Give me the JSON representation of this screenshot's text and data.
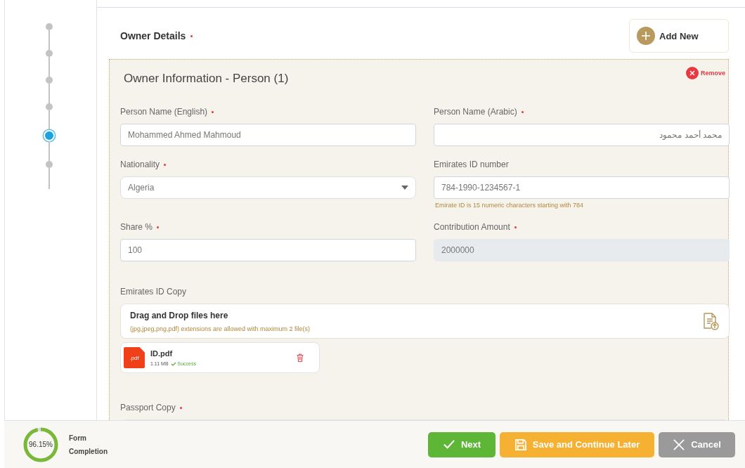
{
  "stepper": {
    "steps": [
      {
        "selected": false
      },
      {
        "selected": false
      },
      {
        "selected": false
      },
      {
        "selected": false
      },
      {
        "selected": true
      },
      {
        "selected": false
      }
    ]
  },
  "section": {
    "title": "Owner Details",
    "required": true,
    "add_button": "Add New"
  },
  "owner_card": {
    "title": "Owner Information - Person (1)",
    "remove_label": "Remove",
    "fields": [
      {
        "label": "Person Name (English)",
        "required": true,
        "kind": "text",
        "value": "Mohammed Ahmed Mahmoud"
      },
      {
        "label": "Person Name (Arabic)",
        "required": true,
        "kind": "text",
        "value": "محمد أحمد محمود"
      },
      {
        "label": "Nationality",
        "required": true,
        "kind": "select",
        "value": "Algeria"
      },
      {
        "label": "Emirates ID number",
        "kind": "text",
        "value": "784-1990-1234567-1",
        "hint": "Emirate ID is 15 numeric characters starting with 784"
      },
      {
        "label": "Share %",
        "required": true,
        "kind": "text",
        "value": "100"
      },
      {
        "label": "Contribution Amount",
        "required": true,
        "kind": "readonly",
        "value": "2000000"
      }
    ],
    "uploads": [
      {
        "label": "Emirates ID Copy",
        "dropzone_title": "Drag and Drop files here",
        "dropzone_hint": "(jpg,jpeg,png,pdf) extensions are allowed with maximum 2 file(s)",
        "files": [
          {
            "name": "ID.pdf",
            "type": ".pdf",
            "size": "1.11 MB",
            "status": "Success"
          }
        ]
      },
      {
        "label": "Passport Copy",
        "required": true
      }
    ]
  },
  "footer": {
    "progress": {
      "reading": "96.15%",
      "level": 0.9615,
      "label": "Form Completion"
    },
    "buttons": [
      {
        "label": "Next",
        "kind": "next"
      },
      {
        "label": "Save and Continue Later",
        "kind": "save"
      },
      {
        "label": "Cancel",
        "kind": "cancel"
      }
    ]
  }
}
